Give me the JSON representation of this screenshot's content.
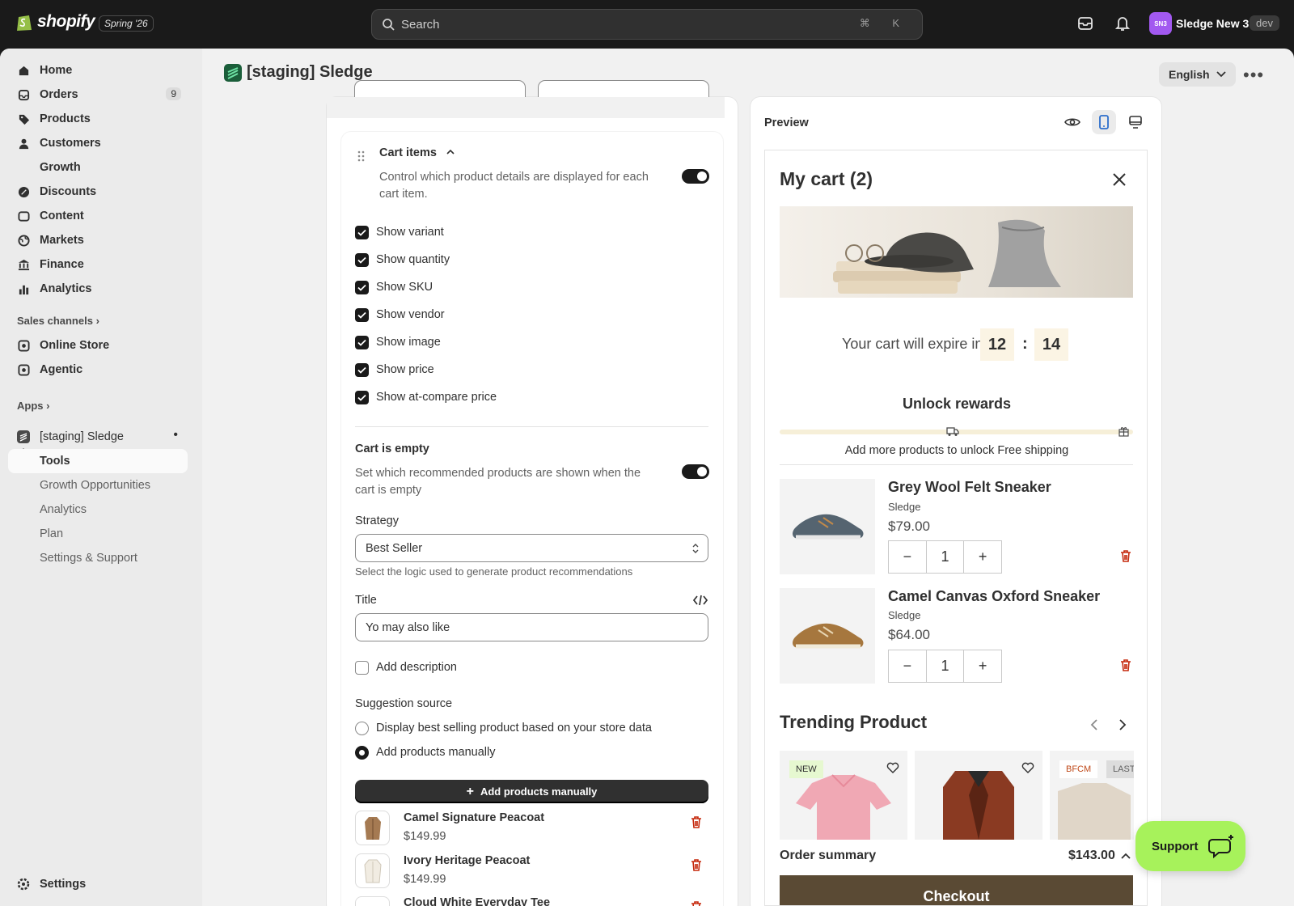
{
  "topbar": {
    "logo_text": "shopify",
    "edition": "Spring '26",
    "search_placeholder": "Search",
    "search_shortcut": "⌘ K",
    "store_initials": "SN3",
    "store_name": "Sledge New 3",
    "store_badge": "dev"
  },
  "sidebar": {
    "items": [
      {
        "label": "Home",
        "icon": "home-icon"
      },
      {
        "label": "Orders",
        "icon": "orders-icon",
        "badge": "9"
      },
      {
        "label": "Products",
        "icon": "tag-icon"
      },
      {
        "label": "Customers",
        "icon": "person-icon"
      },
      {
        "label": "Growth",
        "icon": "growth-icon"
      },
      {
        "label": "Discounts",
        "icon": "discount-icon"
      },
      {
        "label": "Content",
        "icon": "content-icon"
      },
      {
        "label": "Markets",
        "icon": "globe-icon"
      },
      {
        "label": "Finance",
        "icon": "bank-icon"
      },
      {
        "label": "Analytics",
        "icon": "bar-chart-icon"
      }
    ],
    "sales_channels_label": "Sales channels",
    "channels": [
      {
        "label": "Online Store",
        "icon": "store-icon"
      },
      {
        "label": "Agentic",
        "icon": "agentic-icon"
      }
    ],
    "apps_label": "Apps",
    "app_name": "[staging] Sledge",
    "app_subitems": [
      "Tools",
      "Growth Opportunities",
      "Analytics",
      "Plan",
      "Settings & Support"
    ],
    "settings_label": "Settings"
  },
  "page": {
    "title": "[staging] Sledge",
    "language": "English"
  },
  "settings": {
    "cart_items_title": "Cart items",
    "cart_items_desc_1": "Control which product details are displayed for each",
    "cart_items_desc_2": "cart item.",
    "checkboxes": [
      "Show variant",
      "Show quantity",
      "Show SKU",
      "Show vendor",
      "Show image",
      "Show price",
      "Show at-compare price"
    ],
    "empty_title": "Cart is empty",
    "empty_desc_1": "Set which recommended products are shown when the",
    "empty_desc_2": "cart is empty",
    "strategy_label": "Strategy",
    "strategy_value": "Best Seller",
    "strategy_help": "Select the logic used to generate product recommendations",
    "title_label": "Title",
    "title_value": "Yo may also like",
    "add_description": "Add description",
    "suggestion_label": "Suggestion source",
    "radio_best": "Display best selling product based on your store data",
    "radio_manual": "Add products manually",
    "add_button": "Add products manually",
    "products": [
      {
        "name": "Camel Signature Peacoat",
        "price": "$149.99"
      },
      {
        "name": "Ivory Heritage Peacoat",
        "price": "$149.99"
      },
      {
        "name": "Cloud White Everyday Tee",
        "price": ""
      }
    ]
  },
  "preview": {
    "label": "Preview",
    "cart_title": "My cart (2)",
    "expire_text": "Your cart will expire in",
    "minutes": "12",
    "seconds": "14",
    "rewards_title": "Unlock rewards",
    "rewards_text": "Add more products to unlock Free shipping",
    "items": [
      {
        "name": "Grey Wool Felt Sneaker",
        "vendor": "Sledge",
        "price": "$79.00",
        "qty": "1"
      },
      {
        "name": "Camel Canvas Oxford Sneaker",
        "vendor": "Sledge",
        "price": "$64.00",
        "qty": "1"
      }
    ],
    "trending_title": "Trending Product",
    "tags": [
      "NEW",
      "BFCM",
      "LAST"
    ],
    "order_summary": "Order summary",
    "total": "$143.00",
    "checkout": "Checkout"
  },
  "support_label": "Support"
}
